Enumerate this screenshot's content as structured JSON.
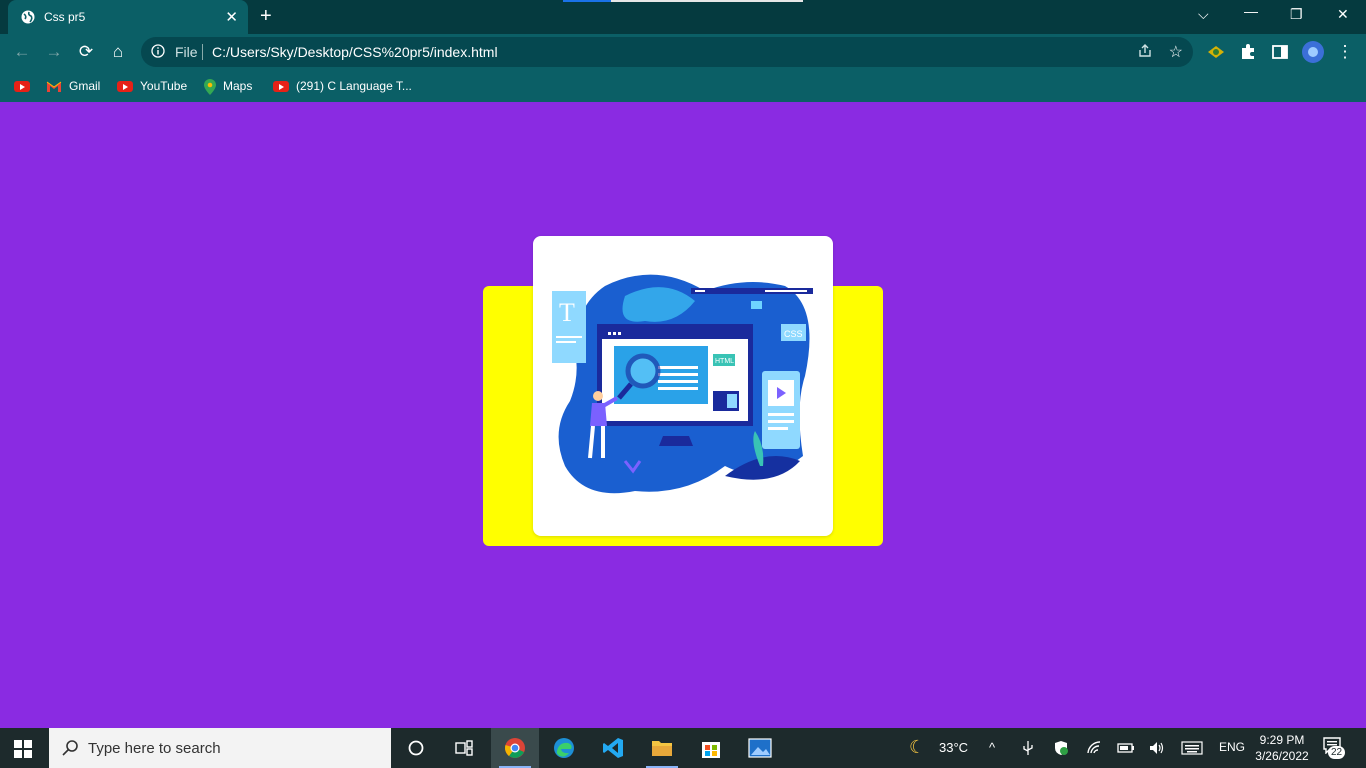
{
  "browser": {
    "tab": {
      "title": "Css pr5"
    },
    "address": {
      "scheme_label": "File",
      "url": "C:/Users/Sky/Desktop/CSS%20pr5/index.html"
    },
    "bookmarks": [
      {
        "label": "",
        "icon": "youtube-icon"
      },
      {
        "label": "Gmail",
        "icon": "gmail-icon"
      },
      {
        "label": "YouTube",
        "icon": "youtube-icon"
      },
      {
        "label": "Maps",
        "icon": "maps-icon"
      },
      {
        "label": "(291) C Language T...",
        "icon": "youtube-icon"
      }
    ]
  },
  "page": {
    "background": "#8a2be2",
    "box_color": "#ffff00",
    "card_color": "#ffffff",
    "illustration_labels": {
      "t_letter": "T",
      "html_tag": "HTML",
      "css_tag": "CSS"
    }
  },
  "taskbar": {
    "search_placeholder": "Type here to search",
    "weather": "33°C",
    "language": "ENG",
    "time": "9:29 PM",
    "date": "3/26/2022",
    "notifications": "22"
  }
}
